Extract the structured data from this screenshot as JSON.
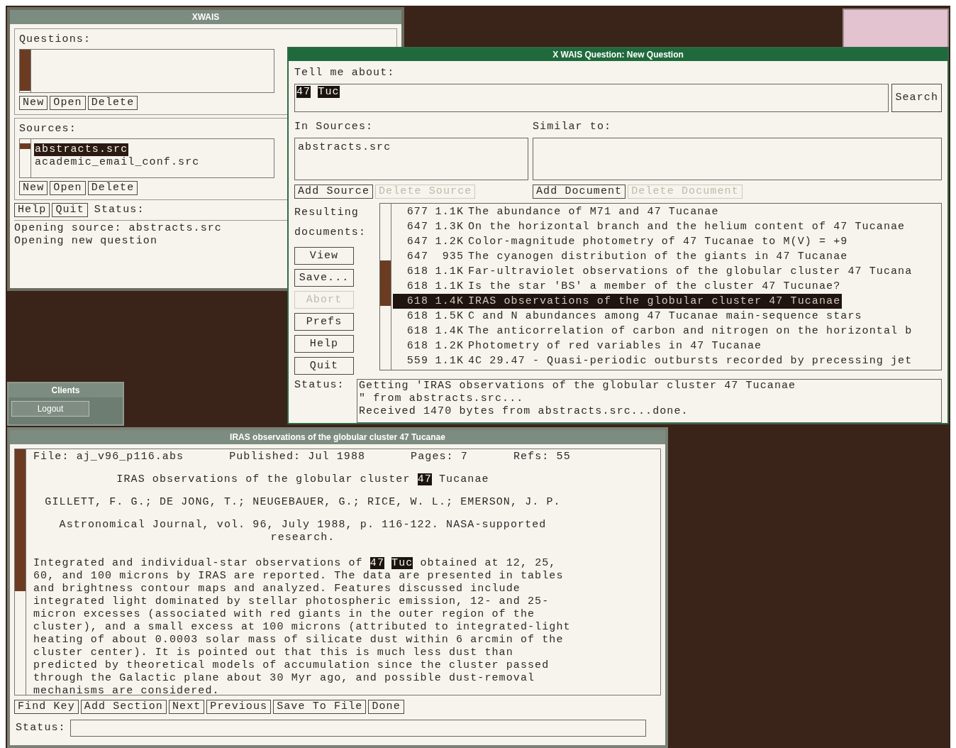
{
  "main_window": {
    "title": "XWAIS",
    "questions_label": "Questions:",
    "question_buttons": [
      "New",
      "Open",
      "Delete"
    ],
    "sources_label": "Sources:",
    "sources": [
      {
        "name": "abstracts.src",
        "selected": true
      },
      {
        "name": "academic_email_conf.src",
        "selected": false
      }
    ],
    "source_buttons": [
      "New",
      "Open",
      "Delete"
    ],
    "bottom_buttons": [
      "Help",
      "Quit"
    ],
    "status_label": "Status:",
    "status_lines": [
      "Opening source: abstracts.src",
      "Opening new question"
    ]
  },
  "question_window": {
    "title": "X WAIS Question: New Question",
    "tell_label": "Tell me about:",
    "query": [
      {
        "text": "47",
        "highlighted": true
      },
      {
        "text": "Tuc",
        "highlighted": true
      }
    ],
    "search_button": "Search",
    "sources_label": "In Sources:",
    "sources": [
      "abstracts.src"
    ],
    "similar_label": "Similar to:",
    "source_buttons": [
      {
        "label": "Add Source",
        "disabled": false
      },
      {
        "label": "Delete Source",
        "disabled": true
      }
    ],
    "document_buttons": [
      {
        "label": "Add Document",
        "disabled": false
      },
      {
        "label": "Delete Document",
        "disabled": true
      }
    ],
    "results_label": [
      "Resulting",
      "documents:"
    ],
    "side_buttons": [
      {
        "label": "View",
        "disabled": false
      },
      {
        "label": "Save...",
        "disabled": false
      },
      {
        "label": "Abort",
        "disabled": true
      },
      {
        "label": "Prefs",
        "disabled": false
      },
      {
        "label": "Help",
        "disabled": false
      },
      {
        "label": "Quit",
        "disabled": false
      }
    ],
    "results": [
      {
        "score": "677",
        "size": "1.1K",
        "title": "The abundance of M71 and 47 Tucanae",
        "selected": false
      },
      {
        "score": "647",
        "size": "1.3K",
        "title": "On the horizontal branch and the helium content of 47 Tucanae",
        "selected": false
      },
      {
        "score": "647",
        "size": "1.2K",
        "title": "Color-magnitude photometry of 47 Tucanae to M(V) = +9",
        "selected": false
      },
      {
        "score": "647",
        "size": "935",
        "title": "The cyanogen distribution of the giants in 47 Tucanae",
        "selected": false
      },
      {
        "score": "618",
        "size": "1.1K",
        "title": "Far-ultraviolet observations of the globular cluster 47 Tucana",
        "selected": false
      },
      {
        "score": "618",
        "size": "1.1K",
        "title": "Is the star 'BS' a member of the cluster 47 Tucunae?",
        "selected": false
      },
      {
        "score": "618",
        "size": "1.4K",
        "title": "IRAS observations of the globular cluster 47 Tucanae",
        "selected": true
      },
      {
        "score": "618",
        "size": "1.5K",
        "title": "C and N abundances among 47 Tucanae main-sequence stars",
        "selected": false
      },
      {
        "score": "618",
        "size": "1.4K",
        "title": "The anticorrelation of carbon and nitrogen on the horizontal b",
        "selected": false
      },
      {
        "score": "618",
        "size": "1.2K",
        "title": "Photometry of red variables in 47 Tucanae",
        "selected": false
      },
      {
        "score": "559",
        "size": "1.1K",
        "title": "4C 29.47 - Quasi-periodic outbursts recorded by precessing jet",
        "selected": false
      }
    ],
    "status_label": "Status:",
    "status_lines": [
      "Getting 'IRAS observations of the globular cluster 47 Tucanae",
      "\" from abstracts.src...",
      "Received 1470 bytes from abstracts.src...done."
    ]
  },
  "clients_window": {
    "title": "Clients",
    "button": "Logout"
  },
  "document_window": {
    "title": "IRAS observations of the globular cluster 47 Tucanae",
    "meta": [
      {
        "label": "File:",
        "value": "aj_v96_p116.abs"
      },
      {
        "label": "Published:",
        "value": "Jul 1988"
      },
      {
        "label": "Pages:",
        "value": "7"
      },
      {
        "label": "Refs:",
        "value": "55"
      }
    ],
    "heading": [
      {
        "text": "IRAS observations of the globular cluster",
        "highlighted": false
      },
      {
        "text": "47",
        "highlighted": true
      },
      {
        "text": "Tucanae",
        "highlighted": false
      }
    ],
    "authors": "GILLETT, F. G.; DE JONG, T.; NEUGEBAUER, G.; RICE, W. L.; EMERSON, J. P.",
    "citation": "Astronomical Journal, vol. 96, July 1988, p. 116-122. NASA-supported research.",
    "abstract": [
      {
        "text": "Integrated and individual-star observations of",
        "highlighted": false
      },
      {
        "text": "47",
        "highlighted": true
      },
      {
        "text": "Tuc",
        "highlighted": true
      },
      {
        "text": "obtained at 12, 25, 60, and 100 microns by IRAS are reported. The data are presented in tables and brightness contour maps and analyzed. Features discussed include integrated light dominated by stellar photospheric emission, 12- and 25-micron excesses (associated with red giants in the outer region of the cluster), and a small excess at 100 microns (attributed to integrated-light heating of about 0.0003 solar mass of silicate dust within 6 arcmin of the cluster center). It is pointed out that this is much less dust than predicted by theoretical models of accumulation since the cluster passed through the Galactic plane about 30 Myr ago, and possible dust-removal mechanisms are considered.",
        "highlighted": false
      }
    ],
    "buttons": [
      "Find Key",
      "Add Section",
      "Next",
      "Previous",
      "Save To File",
      "Done"
    ],
    "status_label": "Status:"
  }
}
